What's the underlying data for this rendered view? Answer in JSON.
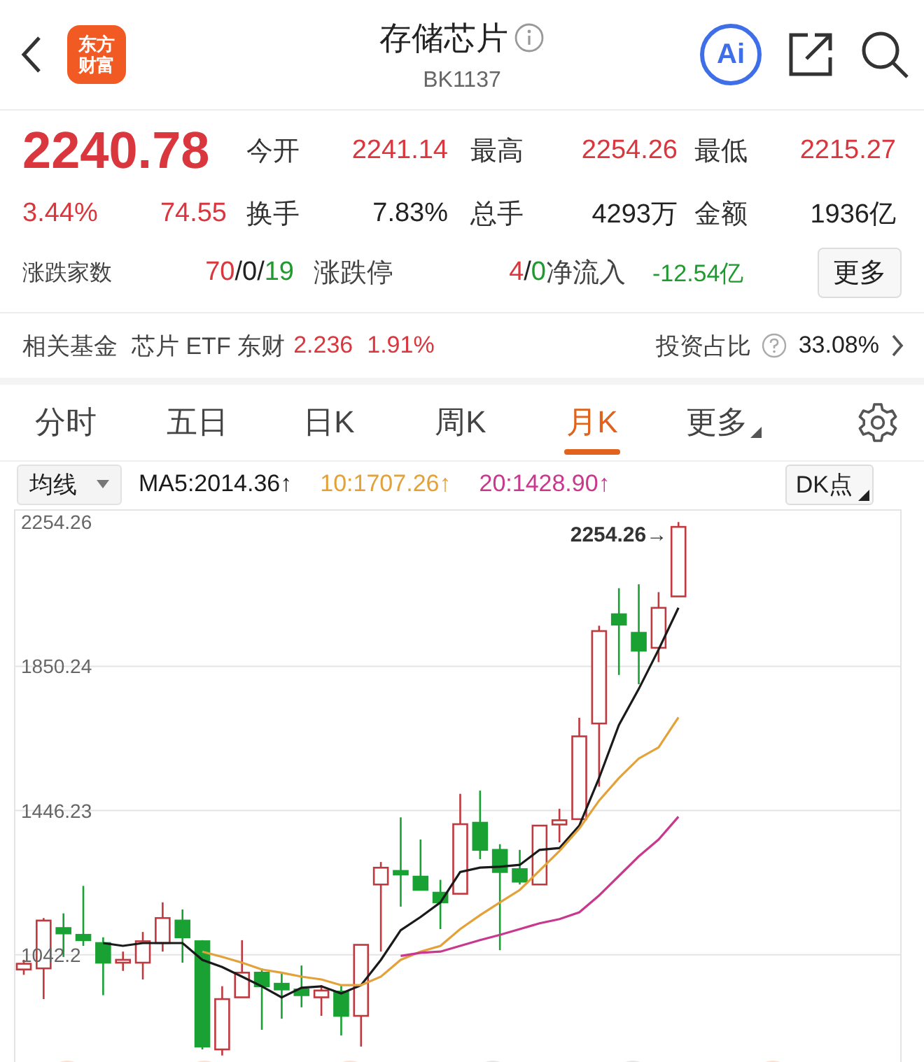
{
  "header": {
    "logo_lines": [
      "东方",
      "财富"
    ],
    "title": "存储芯片",
    "code": "BK1137",
    "ai_label": "Ai"
  },
  "quote": {
    "price": "2240.78",
    "change_percent": "3.44%",
    "change": "74.55",
    "stats": [
      {
        "label": "今开",
        "value": "2241.14",
        "color": "#d9363e"
      },
      {
        "label": "最高",
        "value": "2254.26",
        "color": "#d9363e"
      },
      {
        "label": "最低",
        "value": "2215.27",
        "color": "#d9363e"
      },
      {
        "label": "换手",
        "value": "7.83%",
        "color": "#222222"
      },
      {
        "label": "总手",
        "value": "4293万",
        "color": "#222222"
      },
      {
        "label": "金额",
        "value": "1936亿",
        "color": "#222222"
      }
    ]
  },
  "breadth": [
    {
      "label": "涨跌家数",
      "parts": [
        {
          "text": "70",
          "color": "#d9363e"
        },
        {
          "text": "/",
          "color": "#222222"
        },
        {
          "text": "0",
          "color": "#222222"
        },
        {
          "text": "/",
          "color": "#222222"
        },
        {
          "text": "19",
          "color": "#1f9a2e"
        }
      ]
    },
    {
      "label": "涨跌停",
      "parts": [
        {
          "text": "4",
          "color": "#d9363e"
        },
        {
          "text": "/",
          "color": "#222222"
        },
        {
          "text": "0",
          "color": "#1f9a2e"
        }
      ]
    },
    {
      "label": "净流入",
      "parts": [
        {
          "text": "-12.54亿",
          "color": "#1f9a2e"
        }
      ]
    }
  ],
  "more_button": "更多",
  "fund": {
    "label": "相关基金",
    "name": "芯片 ETF 东财",
    "price": "2.236",
    "change": "1.91%",
    "ratio_label": "投资占比",
    "ratio": "33.08%"
  },
  "tabs": [
    {
      "label": "分时",
      "selected": false,
      "kind": "tab"
    },
    {
      "label": "五日",
      "selected": false,
      "kind": "tab"
    },
    {
      "label": "日K",
      "selected": false,
      "kind": "tab"
    },
    {
      "label": "周K",
      "selected": false,
      "kind": "tab"
    },
    {
      "label": "月K",
      "selected": true,
      "kind": "tab"
    },
    {
      "label": "更多",
      "selected": false,
      "kind": "dropdown"
    }
  ],
  "indicators": {
    "selector": "均线",
    "dk_button": "DK点"
  },
  "chart": {
    "chart_data": {
      "type": "candlestick",
      "ylim": [
        730,
        2290
      ],
      "grid": true,
      "series": [
        {
          "type": "line",
          "name": "MA5:2014.36↑",
          "color": "#1a1a1a",
          "values": [
            null,
            null,
            null,
            null,
            1075,
            1067,
            1075,
            1075,
            1075,
            1028,
            1008,
            981,
            954,
            923,
            950,
            954,
            934,
            957,
            1028,
            1111,
            1148,
            1189,
            1274,
            1286,
            1289,
            1294,
            1336,
            1341,
            1404,
            1537,
            1686,
            1787,
            1897,
            2014
          ]
        },
        {
          "type": "line",
          "name": "10:1707.26↑",
          "color": "#e3a13a",
          "values": [
            null,
            null,
            null,
            null,
            null,
            null,
            null,
            null,
            null,
            1051,
            1036,
            1020,
            1001,
            992,
            981,
            973,
            957,
            957,
            981,
            1028,
            1051,
            1067,
            1114,
            1153,
            1189,
            1224,
            1278,
            1333,
            1396,
            1474,
            1537,
            1592,
            1623,
            1707
          ]
        },
        {
          "type": "line",
          "name": "20:1428.90↑",
          "color": "#c8388e",
          "values": [
            null,
            null,
            null,
            null,
            null,
            null,
            null,
            null,
            null,
            null,
            null,
            null,
            null,
            null,
            null,
            null,
            null,
            null,
            null,
            1039,
            1048,
            1051,
            1067,
            1083,
            1098,
            1114,
            1130,
            1142,
            1161,
            1208,
            1263,
            1318,
            1365,
            1429
          ]
        }
      ],
      "yticks": [
        {
          "value": 2254.26,
          "label": "2254.26"
        },
        {
          "value": 1850.24,
          "label": "1850.24"
        },
        {
          "value": 1446.23,
          "label": "1446.23"
        },
        {
          "value": 1042.22,
          "label": "1042.2"
        }
      ],
      "ohlc": [
        [
          1001,
          1028,
          986,
          1017
        ],
        [
          1004,
          1145,
          918,
          1138
        ],
        [
          1117,
          1158,
          1036,
          1102
        ],
        [
          1098,
          1235,
          1067,
          1083
        ],
        [
          1075,
          1091,
          929,
          1020
        ],
        [
          1020,
          1051,
          997,
          1028
        ],
        [
          1020,
          1106,
          973,
          1080
        ],
        [
          1075,
          1189,
          1051,
          1145
        ],
        [
          1138,
          1169,
          1020,
          1091
        ],
        [
          1080,
          1083,
          777,
          785
        ],
        [
          777,
          954,
          760,
          918
        ],
        [
          923,
          1083,
          923,
          992
        ],
        [
          992,
          1004,
          832,
          954
        ],
        [
          961,
          989,
          863,
          945
        ],
        [
          945,
          1012,
          895,
          929
        ],
        [
          923,
          957,
          871,
          942
        ],
        [
          939,
          957,
          816,
          871
        ],
        [
          871,
          1070,
          785,
          1070
        ],
        [
          1239,
          1302,
          1051,
          1286
        ],
        [
          1277,
          1427,
          1177,
          1267
        ],
        [
          1261,
          1365,
          1224,
          1224
        ],
        [
          1216,
          1252,
          1114,
          1189
        ],
        [
          1213,
          1493,
          1213,
          1408
        ],
        [
          1412,
          1502,
          1310,
          1336
        ],
        [
          1336,
          1352,
          1055,
          1274
        ],
        [
          1282,
          1336,
          1239,
          1247
        ],
        [
          1239,
          1404,
          1239,
          1404
        ],
        [
          1407,
          1451,
          1357,
          1419
        ],
        [
          1422,
          1706,
          1422,
          1654
        ],
        [
          1690,
          1964,
          1513,
          1949
        ],
        [
          1996,
          2069,
          1826,
          1967
        ],
        [
          1944,
          2080,
          1800,
          1894
        ],
        [
          1902,
          2058,
          1862,
          2014
        ],
        [
          2046,
          2254.26,
          2046,
          2240.78
        ]
      ],
      "annotations": [
        "2254.26→"
      ]
    }
  }
}
